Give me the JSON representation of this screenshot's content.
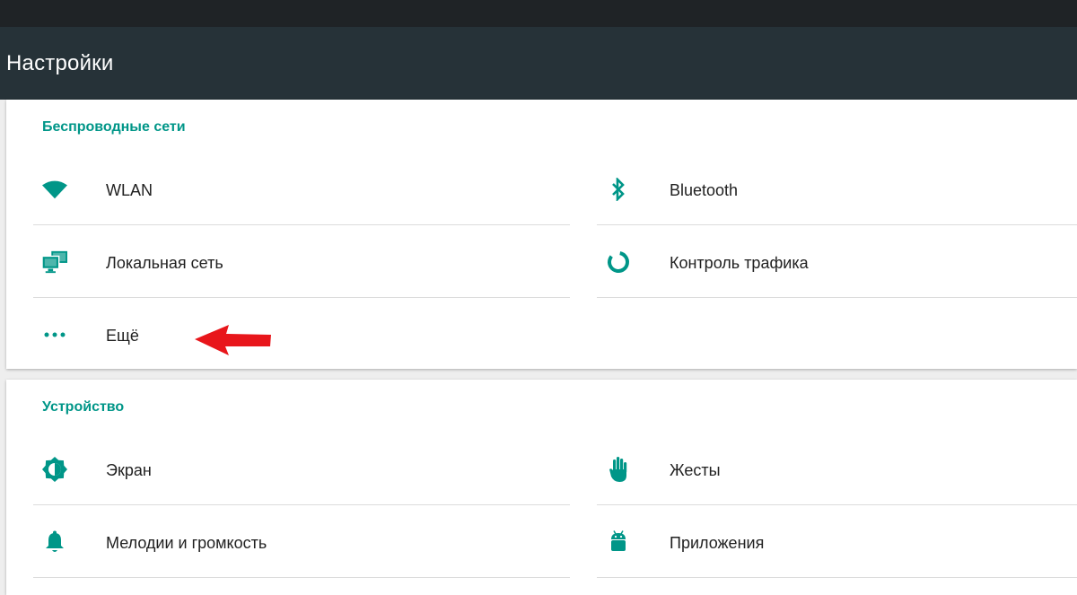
{
  "app": {
    "title": "Настройки"
  },
  "colors": {
    "accent": "#009688",
    "app_bar": "#263238",
    "status_bar": "#1f2326",
    "arrow": "#e8161b"
  },
  "sections": [
    {
      "title": "Беспроводные сети",
      "items": [
        {
          "label": "WLAN",
          "icon": "wifi-icon"
        },
        {
          "label": "Bluetooth",
          "icon": "bluetooth-icon"
        },
        {
          "label": "Локальная сеть",
          "icon": "ethernet-icon"
        },
        {
          "label": "Контроль трафика",
          "icon": "data-usage-icon"
        },
        {
          "label": "Ещё",
          "icon": "more-icon"
        }
      ]
    },
    {
      "title": "Устройство",
      "items": [
        {
          "label": "Экран",
          "icon": "brightness-icon"
        },
        {
          "label": "Жесты",
          "icon": "hand-icon"
        },
        {
          "label": "Мелодии и громкость",
          "icon": "bell-icon"
        },
        {
          "label": "Приложения",
          "icon": "android-icon"
        }
      ]
    }
  ]
}
